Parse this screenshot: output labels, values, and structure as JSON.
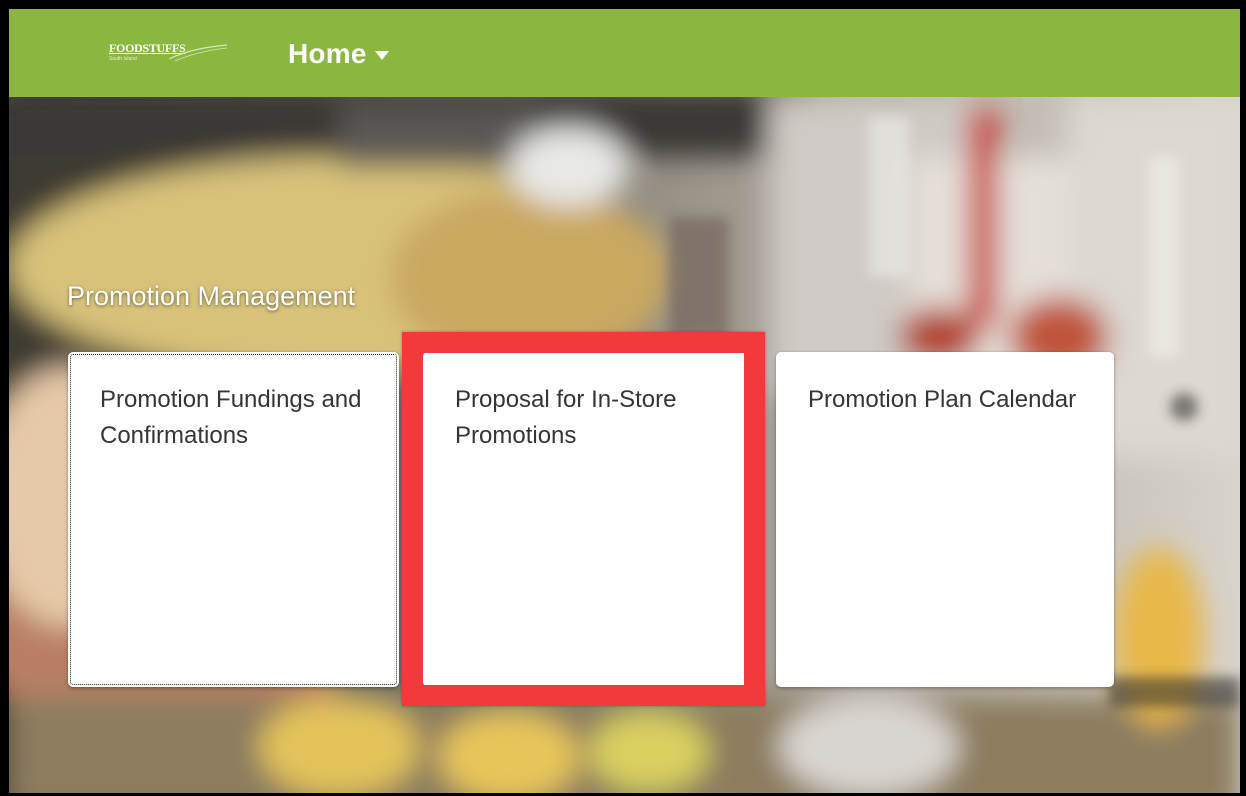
{
  "header": {
    "logo_text": "FOODSTUFFS",
    "logo_subtext": "South Island",
    "menu_label": "Home",
    "background_color": "#8ab73f"
  },
  "group": {
    "title": "Promotion Management"
  },
  "tiles": [
    {
      "title": "Promotion Fundings and Confirmations"
    },
    {
      "title": "Proposal for In-Store Promotions"
    },
    {
      "title": "Promotion Plan Calendar"
    }
  ],
  "annotation": {
    "color": "#f2393b"
  },
  "icons": {
    "menu_caret": "caret-down-icon",
    "logo": "foodstuffs-logo"
  }
}
